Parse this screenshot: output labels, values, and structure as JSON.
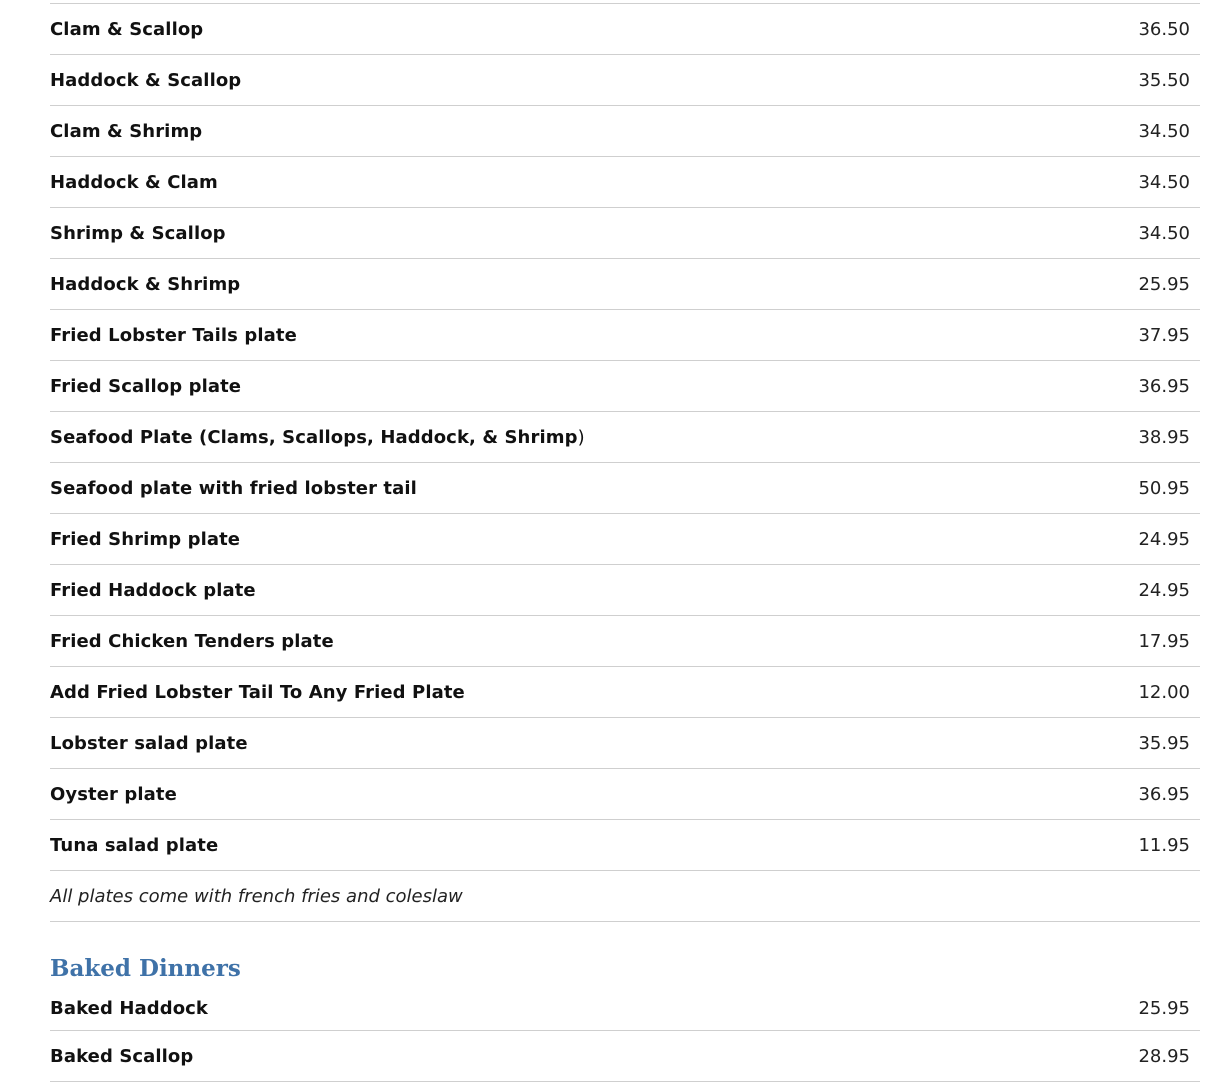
{
  "items": [
    {
      "name": "Clam & Scallop",
      "price": "36.50"
    },
    {
      "name": "Haddock & Scallop",
      "price": "35.50"
    },
    {
      "name": "Clam & Shrimp",
      "price": "34.50"
    },
    {
      "name": "Haddock & Clam",
      "price": "34.50"
    },
    {
      "name": "Shrimp & Scallop",
      "price": "34.50"
    },
    {
      "name": "Haddock & Shrimp",
      "price": "25.95"
    },
    {
      "name": "Fried Lobster Tails plate",
      "price": "37.95"
    },
    {
      "name": "Fried Scallop plate",
      "price": "36.95"
    },
    {
      "name": "Seafood Plate (Clams, Scallops, Haddock, & Shrimp",
      "suffix": ")",
      "price": "38.95"
    },
    {
      "name": "Seafood plate with fried lobster tail",
      "price": "50.95"
    },
    {
      "name": "Fried Shrimp plate",
      "price": "24.95"
    },
    {
      "name": "Fried Haddock plate",
      "price": "24.95"
    },
    {
      "name": "Fried Chicken Tenders plate",
      "price": "17.95"
    },
    {
      "name": "Add Fried Lobster Tail To Any Fried Plate",
      "price": "12.00"
    },
    {
      "name": "Lobster salad plate",
      "price": "35.95"
    },
    {
      "name": "Oyster plate",
      "price": "36.95"
    },
    {
      "name": "Tuna salad plate",
      "price": "11.95"
    }
  ],
  "note": "All plates come with french fries and coleslaw",
  "baked": {
    "title": "Baked Dinners",
    "items": [
      {
        "name": "Baked Haddock",
        "price": "25.95"
      },
      {
        "name": "Baked Scallop",
        "price": "28.95"
      }
    ]
  },
  "colors": {
    "section_title": "#3f72a8",
    "rule": "#cfcfcf",
    "text": "#111111"
  }
}
